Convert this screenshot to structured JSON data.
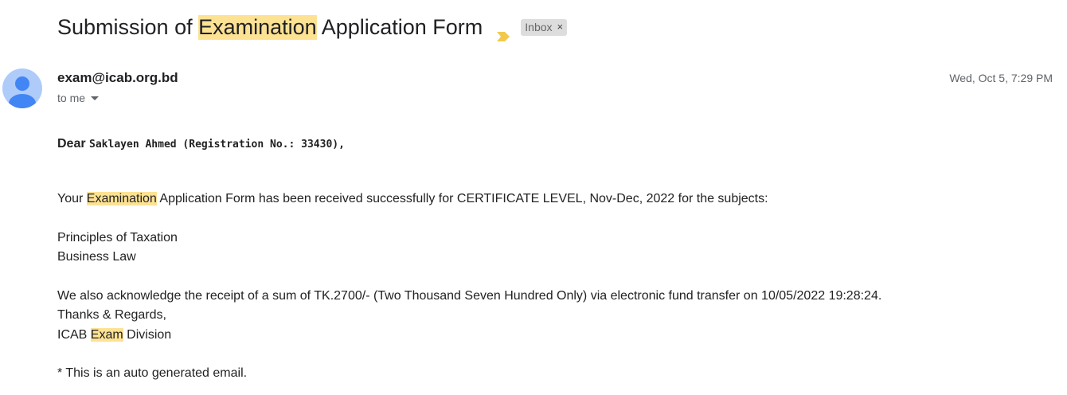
{
  "subject": {
    "part1": "Submission of ",
    "highlight": "Examination",
    "part2": " Application Form",
    "label_badge": "Inbox",
    "label_remove": "×"
  },
  "sender": {
    "email": "exam@icab.org.bd",
    "recipient": "to me",
    "date": "Wed, Oct 5, 7:29 PM"
  },
  "body": {
    "greeting_word": "Dear",
    "greeting_rest": "Saklayen Ahmed (Registration No.: 33430),",
    "line1_pre": "Your ",
    "line1_hl": "Examination",
    "line1_post": " Application Form has been received successfully for CERTIFICATE LEVEL, Nov-Dec, 2022 for the subjects:",
    "subjects": [
      "Principles of Taxation",
      "Business Law"
    ],
    "ack": "We also acknowledge the receipt of a sum of TK.2700/- (Two Thousand Seven Hundred Only) via electronic fund transfer on 10/05/2022 19:28:24.",
    "thanks": "Thanks & Regards,",
    "sig_pre": "ICAB ",
    "sig_hl": "Exam",
    "sig_post": " Division",
    "footer": "* This is an auto generated email."
  },
  "colors": {
    "highlight": "#fde293",
    "importance_marker": "#f2c94c",
    "avatar_bg": "#aecbfa",
    "avatar_fg": "#4285f4"
  }
}
